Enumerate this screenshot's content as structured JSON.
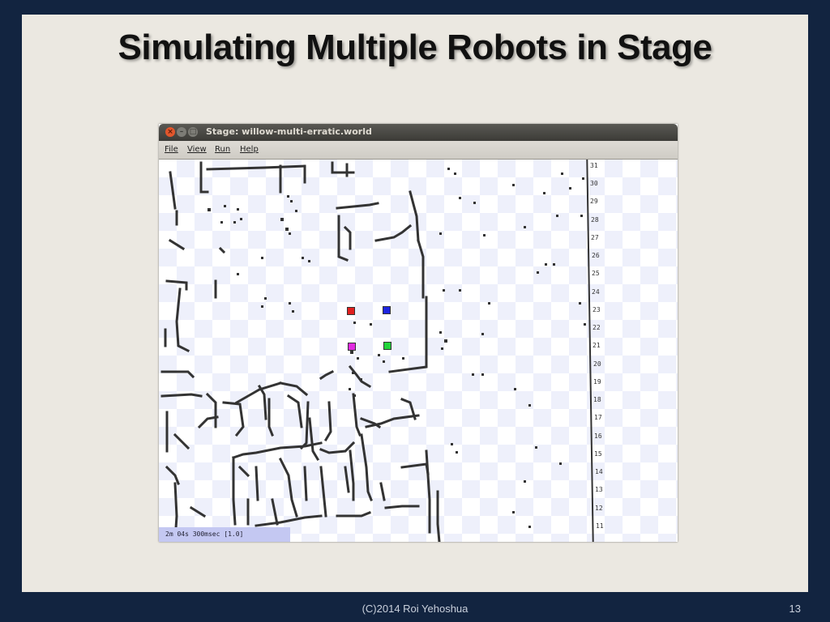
{
  "slide": {
    "title": "Simulating Multiple Robots in Stage",
    "footer": "(C)2014 Roi Yehoshua",
    "page_number": "13"
  },
  "window": {
    "title": "Stage: willow-multi-erratic.world",
    "controls": [
      "close-icon",
      "minimize-icon",
      "maximize-icon"
    ]
  },
  "menu": {
    "file": "File",
    "view": "View",
    "run": "Run",
    "help": "Help"
  },
  "ruler": {
    "ticks": [
      "31",
      "30",
      "29",
      "28",
      "27",
      "26",
      "25",
      "24",
      "23",
      "22",
      "21",
      "20",
      "19",
      "18",
      "17",
      "16",
      "15",
      "14",
      "13",
      "12",
      "11"
    ]
  },
  "robots": [
    {
      "name": "red",
      "color": "#e0201f"
    },
    {
      "name": "blue",
      "color": "#1d25e0"
    },
    {
      "name": "magenta",
      "color": "#e02ae0"
    },
    {
      "name": "green",
      "color": "#22d43a"
    }
  ],
  "status": {
    "text": "2m 04s 300msec [1.0]"
  }
}
